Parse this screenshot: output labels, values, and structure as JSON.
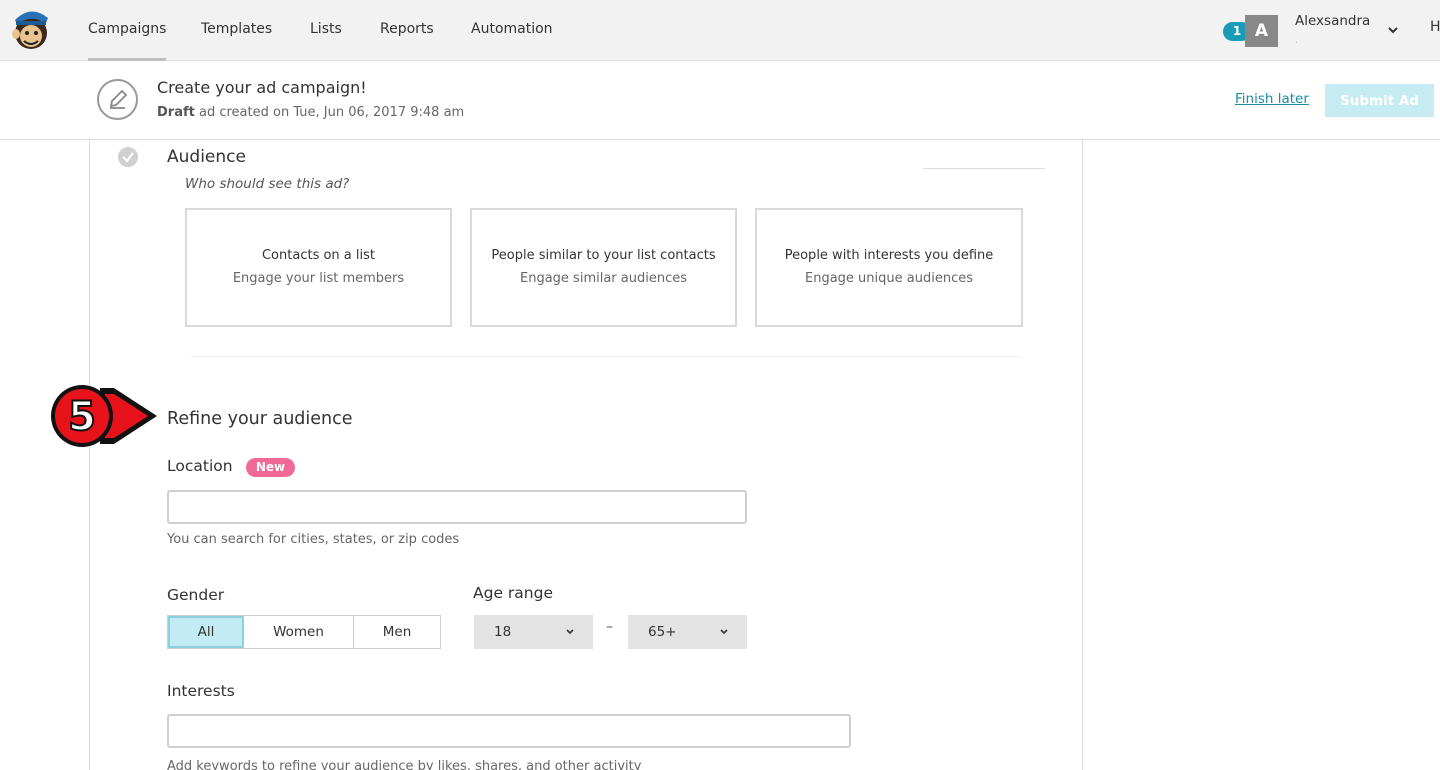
{
  "nav": {
    "tabs": [
      {
        "label": "Campaigns"
      },
      {
        "label": "Templates"
      },
      {
        "label": "Lists"
      },
      {
        "label": "Reports"
      },
      {
        "label": "Automation"
      }
    ],
    "notification_count": "1",
    "avatar_initial": "A",
    "user_name": "Alexsandra",
    "user_sub": ".",
    "cut_label": "H"
  },
  "header": {
    "title": "Create your ad campaign!",
    "status": "Draft",
    "subtitle": " ad created on Tue, Jun 06, 2017 9:48 am",
    "finish_later": "Finish later",
    "submit": "Submit Ad"
  },
  "audience": {
    "title": "Audience",
    "question": "Who should see this ad?",
    "options": [
      {
        "title": "Contacts on a list",
        "desc": "Engage your list members"
      },
      {
        "title": "People similar to your list contacts",
        "desc": "Engage similar audiences"
      },
      {
        "title": "People with interests you define",
        "desc": "Engage unique audiences"
      }
    ]
  },
  "callout": {
    "number": "5",
    "color": "#e8121b"
  },
  "refine": {
    "title": "Refine your audience",
    "location_label": "Location",
    "new_badge": "New",
    "location_value": "",
    "location_help": "You can search for cities, states, or zip codes",
    "gender_label": "Gender",
    "gender_options": [
      "All",
      "Women",
      "Men"
    ],
    "gender_selected": "All",
    "age_label": "Age range",
    "age_min": "18",
    "age_dash": "–",
    "age_max": "65+",
    "interests_label": "Interests",
    "interests_value": "",
    "interests_help": "Add keywords to refine your audience by likes, shares, and other activity"
  },
  "colors": {
    "accent": "#1a8aa6",
    "badge_new": "#f06996",
    "selected_bg": "#c3ebf2",
    "submit_disabled": "#c7ebf2"
  }
}
